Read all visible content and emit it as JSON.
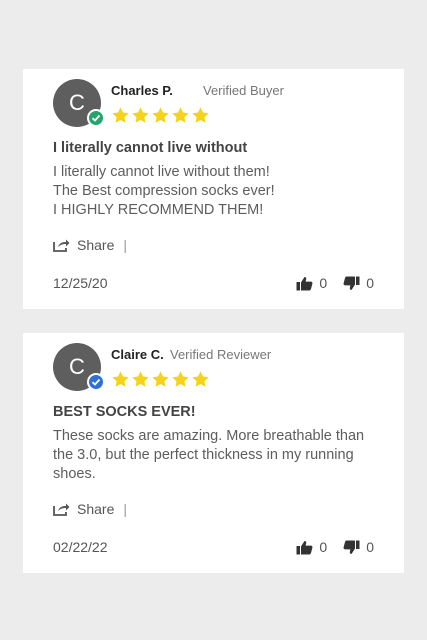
{
  "reviews": [
    {
      "avatar_letter": "C",
      "badge_color": "#24a56a",
      "name": "Charles P.",
      "role": "Verified Buyer",
      "rating": 5,
      "title": "I literally cannot live without",
      "body_lines": [
        "I literally cannot live without them!",
        "The Best compression socks ever!",
        "I HIGHLY RECOMMEND THEM!"
      ],
      "share_label": "Share",
      "share_sep": "|",
      "date": "12/25/20",
      "thumbs_up": "0",
      "thumbs_down": "0"
    },
    {
      "avatar_letter": "C",
      "badge_color": "#2f71d6",
      "name": "Claire C.",
      "role": "Verified Reviewer",
      "rating": 5,
      "title": "BEST SOCKS EVER!",
      "body_lines": [
        "These socks are amazing. More breathable than the 3.0, but the perfect thickness in my running shoes."
      ],
      "share_label": "Share",
      "share_sep": "|",
      "date": "02/22/22",
      "thumbs_up": "0",
      "thumbs_down": "0"
    }
  ],
  "colors": {
    "star": "#f5d21b",
    "page_background": "#ececec",
    "avatar": "#5e5e5e"
  }
}
